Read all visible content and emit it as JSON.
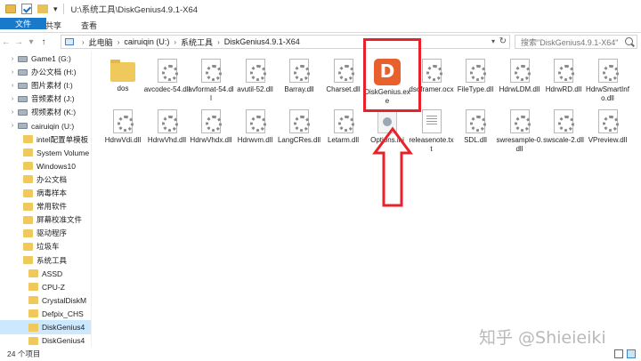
{
  "window": {
    "title": "U:\\系统工具\\DiskGenius4.9.1-X64"
  },
  "ribbon": {
    "tabs": [
      "文件",
      "主页",
      "共享",
      "查看"
    ]
  },
  "address": {
    "crumbs": [
      "此电脑",
      "cairuiqin (U:)",
      "系统工具",
      "DiskGenius4.9.1-X64"
    ],
    "search_placeholder": "搜索\"DiskGenius4.9.1-X64\""
  },
  "sidebar": {
    "items": [
      {
        "label": "Game1 (G:)",
        "type": "drive",
        "level": 1
      },
      {
        "label": "办公文档 (H:)",
        "type": "drive",
        "level": 1
      },
      {
        "label": "图片素材 (I:)",
        "type": "drive",
        "level": 1
      },
      {
        "label": "音频素材 (J:)",
        "type": "drive",
        "level": 1
      },
      {
        "label": "视频素材 (K:)",
        "type": "drive",
        "level": 1
      },
      {
        "label": "cairuiqin (U:)",
        "type": "drive",
        "level": 1
      },
      {
        "label": "intel配置单模板",
        "type": "folder",
        "level": 2
      },
      {
        "label": "System Volume",
        "type": "folder",
        "level": 2
      },
      {
        "label": "Windows10",
        "type": "folder",
        "level": 2
      },
      {
        "label": "办公文档",
        "type": "folder",
        "level": 2
      },
      {
        "label": "病毒样本",
        "type": "folder",
        "level": 2
      },
      {
        "label": "常用软件",
        "type": "folder",
        "level": 2
      },
      {
        "label": "屏幕校准文件",
        "type": "folder",
        "level": 2
      },
      {
        "label": "驱动程序",
        "type": "folder",
        "level": 2
      },
      {
        "label": "垃圾车",
        "type": "folder",
        "level": 2
      },
      {
        "label": "系统工具",
        "type": "folder",
        "level": 2
      },
      {
        "label": "ASSD",
        "type": "folder",
        "level": 3
      },
      {
        "label": "CPU-Z",
        "type": "folder",
        "level": 3
      },
      {
        "label": "CrystalDiskM",
        "type": "folder",
        "level": 3
      },
      {
        "label": "Defpix_CHS",
        "type": "folder",
        "level": 3
      },
      {
        "label": "DiskGenius4",
        "type": "folder",
        "level": 3,
        "selected": true
      },
      {
        "label": "DiskGenius4",
        "type": "folder",
        "level": 3
      }
    ]
  },
  "files": [
    {
      "name": "dos",
      "type": "folder"
    },
    {
      "name": "avcodec-54.dll",
      "type": "dll"
    },
    {
      "name": "avformat-54.dll",
      "type": "dll"
    },
    {
      "name": "avutil-52.dll",
      "type": "dll"
    },
    {
      "name": "Barray.dll",
      "type": "dll"
    },
    {
      "name": "Charset.dll",
      "type": "dll"
    },
    {
      "name": "DiskGenius.exe",
      "type": "exe"
    },
    {
      "name": "dsoframer.ocx",
      "type": "dll"
    },
    {
      "name": "FileType.dll",
      "type": "dll"
    },
    {
      "name": "HdrwLDM.dll",
      "type": "dll"
    },
    {
      "name": "HdrwRD.dll",
      "type": "dll"
    },
    {
      "name": "HdrwSmartInfo.dll",
      "type": "dll"
    },
    {
      "name": "HdrwVdi.dll",
      "type": "dll"
    },
    {
      "name": "HdrwVhd.dll",
      "type": "dll"
    },
    {
      "name": "HdrwVhdx.dll",
      "type": "dll"
    },
    {
      "name": "Hdrwvm.dll",
      "type": "dll"
    },
    {
      "name": "LangCRes.dll",
      "type": "dll"
    },
    {
      "name": "Letarm.dll",
      "type": "dll"
    },
    {
      "name": "Options.ini",
      "type": "ini"
    },
    {
      "name": "releasenote.txt",
      "type": "txt"
    },
    {
      "name": "SDL.dll",
      "type": "dll"
    },
    {
      "name": "swresample-0.dll",
      "type": "dll"
    },
    {
      "name": "swscale-2.dll",
      "type": "dll"
    },
    {
      "name": "VPreview.dll",
      "type": "dll"
    }
  ],
  "status": {
    "item_count": "24 个项目"
  },
  "watermark": "知乎 @Shieieiki",
  "colors": {
    "accent": "#1979ca",
    "highlight": "#e8222a",
    "selection": "#cce8ff"
  }
}
